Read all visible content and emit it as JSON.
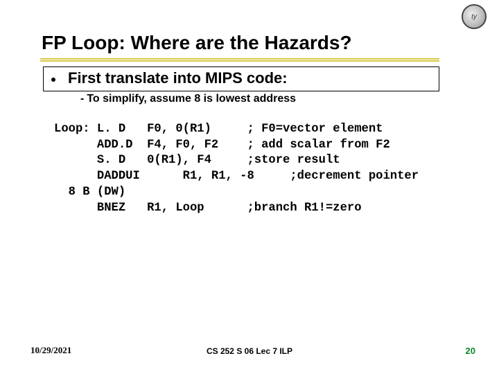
{
  "title": "FP Loop: Where are the Hazards?",
  "bullet": "First translate into MIPS code:",
  "sub": "To simplify, assume 8 is lowest address",
  "code": "Loop: L. D   F0, 0(R1)     ; F0=vector element\n      ADD.D  F4, F0, F2    ; add scalar from F2\n      S. D   0(R1), F4     ;store result\n      DADDUI      R1, R1, -8     ;decrement pointer\n  8 B (DW)\n      BNEZ   R1, Loop      ;branch R1!=zero",
  "footer": {
    "date": "10/29/2021",
    "center": "CS 252 S 06 Lec 7 ILP",
    "num": "20"
  },
  "logo_text": "ty"
}
